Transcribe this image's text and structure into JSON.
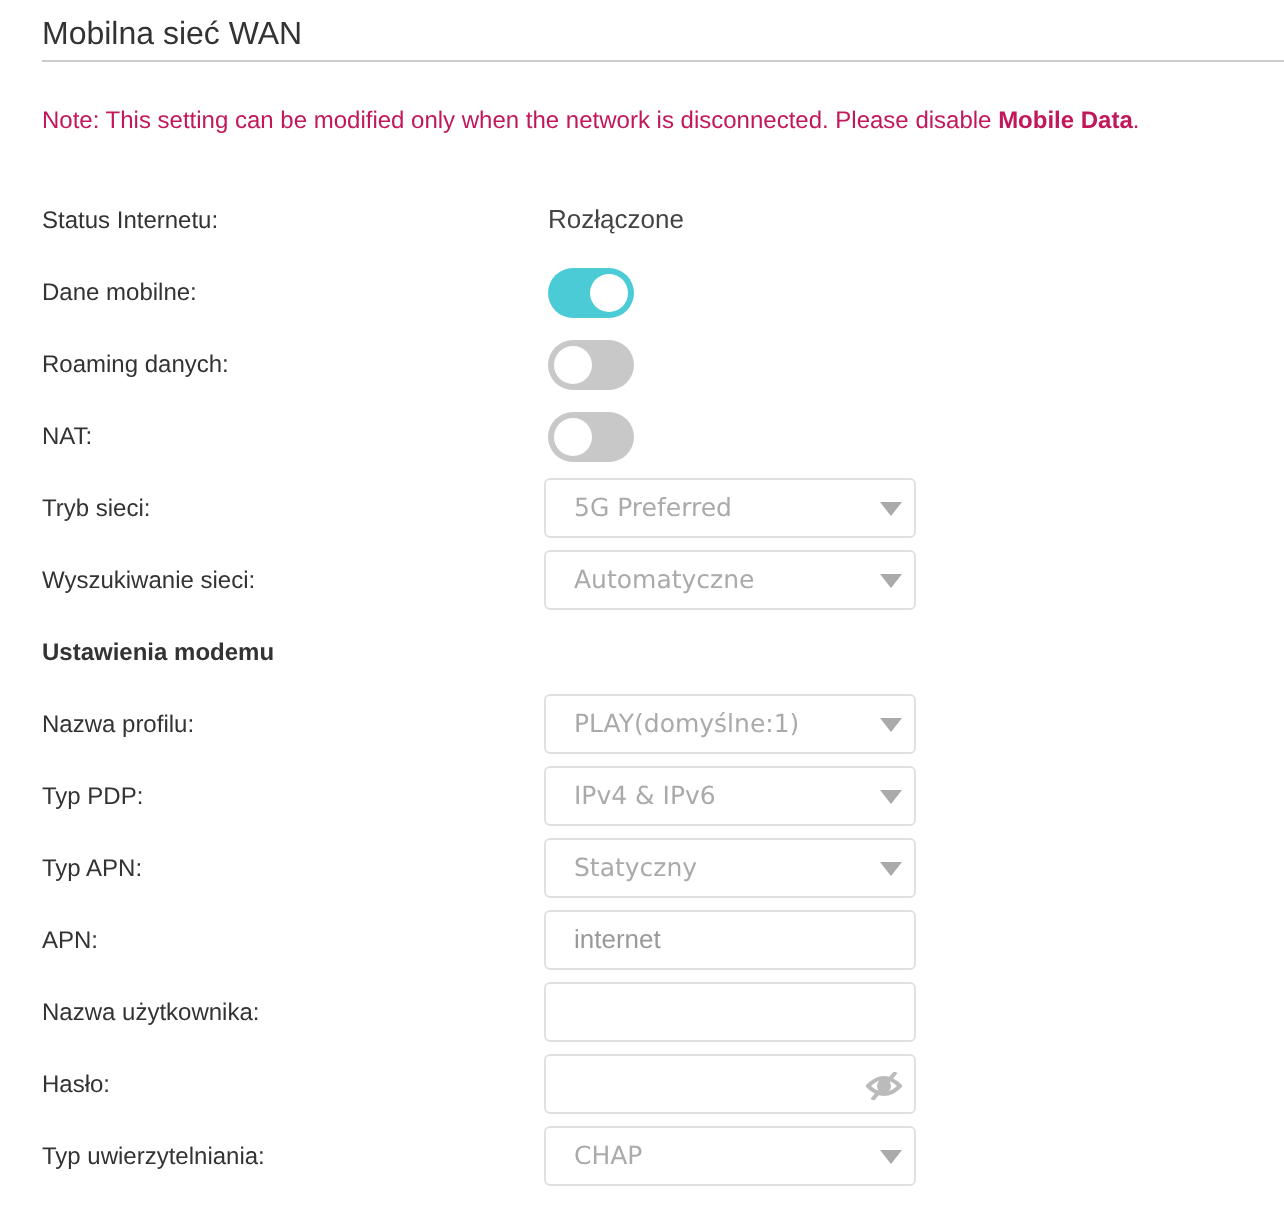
{
  "title": "Mobilna sieć WAN",
  "note": "Note: This setting can be modified only when the network is disconnected. Please disable **Mobile Data**.",
  "rows": [
    {
      "kind": "status",
      "label": "Status Internetu:",
      "value": "Rozłączone"
    },
    {
      "kind": "toggle",
      "label": "Dane mobilne:",
      "on": true
    },
    {
      "kind": "toggle",
      "label": "Roaming danych:",
      "on": false
    },
    {
      "kind": "toggle",
      "label": "NAT:",
      "on": false
    },
    {
      "kind": "select",
      "label": "Tryb sieci:",
      "value": "5G Preferred"
    },
    {
      "kind": "select",
      "label": "Wyszukiwanie sieci:",
      "value": "Automatyczne"
    },
    {
      "kind": "heading",
      "label": "Ustawienia modemu"
    },
    {
      "kind": "select",
      "label": "Nazwa profilu:",
      "value": "PLAY(domyślne:1)"
    },
    {
      "kind": "select",
      "label": "Typ PDP:",
      "value": "IPv4 & IPv6"
    },
    {
      "kind": "select",
      "label": "Typ APN:",
      "value": "Statyczny"
    },
    {
      "kind": "input",
      "label": "APN:",
      "value": "internet"
    },
    {
      "kind": "input",
      "label": "Nazwa użytkownika:"
    },
    {
      "kind": "password",
      "label": "Hasło:"
    },
    {
      "kind": "select",
      "label": "Typ uwierzytelniania:",
      "value": "CHAP"
    }
  ]
}
